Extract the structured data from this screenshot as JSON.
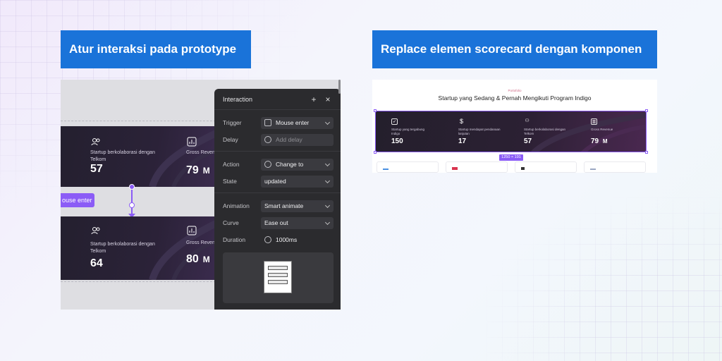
{
  "banners": {
    "left": "Atur interaksi pada prototype",
    "right": "Replace elemen scorecard dengan komponen"
  },
  "left_panel": {
    "cards": [
      {
        "label": "Startup berkolaborasi dengan Telkom",
        "value": "57",
        "label2": "Gross Revenu",
        "value2": "79",
        "unit2": "M"
      },
      {
        "label": "Startup berkolaborasi dengan Telkom",
        "value": "64",
        "label2": "Gross Revenu",
        "value2": "80",
        "unit2": "M"
      }
    ],
    "mouse_tag": "ouse enter",
    "interaction": {
      "title": "Interaction",
      "trigger": {
        "label": "Trigger",
        "value": "Mouse enter"
      },
      "delay": {
        "label": "Delay",
        "placeholder": "Add delay"
      },
      "action": {
        "label": "Action",
        "value": "Change to"
      },
      "state": {
        "label": "State",
        "value": "updated"
      },
      "animation": {
        "label": "Animation",
        "value": "Smart animate"
      },
      "curve": {
        "label": "Curve",
        "value": "Ease out"
      },
      "duration": {
        "label": "Duration",
        "value": "1000ms"
      }
    }
  },
  "right_panel": {
    "eyebrow": "Portofolio",
    "title": "Startup yang Sedang & Pernah Mengikuti Program Indigo",
    "items": [
      {
        "icon": "rocket-icon",
        "label": "Startup yang tergabung Indigo",
        "value": "150",
        "unit": ""
      },
      {
        "icon": "dollar-icon",
        "label": "Startup mendapat pendanaan lanjutan",
        "value": "17",
        "unit": ""
      },
      {
        "icon": "users-icon",
        "label": "Startup berkolaborasi dengan Telkom",
        "value": "57",
        "unit": ""
      },
      {
        "icon": "chart-icon",
        "label": "Gross Revenue",
        "value": "79",
        "unit": "M"
      }
    ],
    "size_tag": "1250 × 191",
    "colors": {
      "accent": "#8b5cf6",
      "banner": "#1a73d9",
      "card_dark": "#241f2c"
    }
  }
}
